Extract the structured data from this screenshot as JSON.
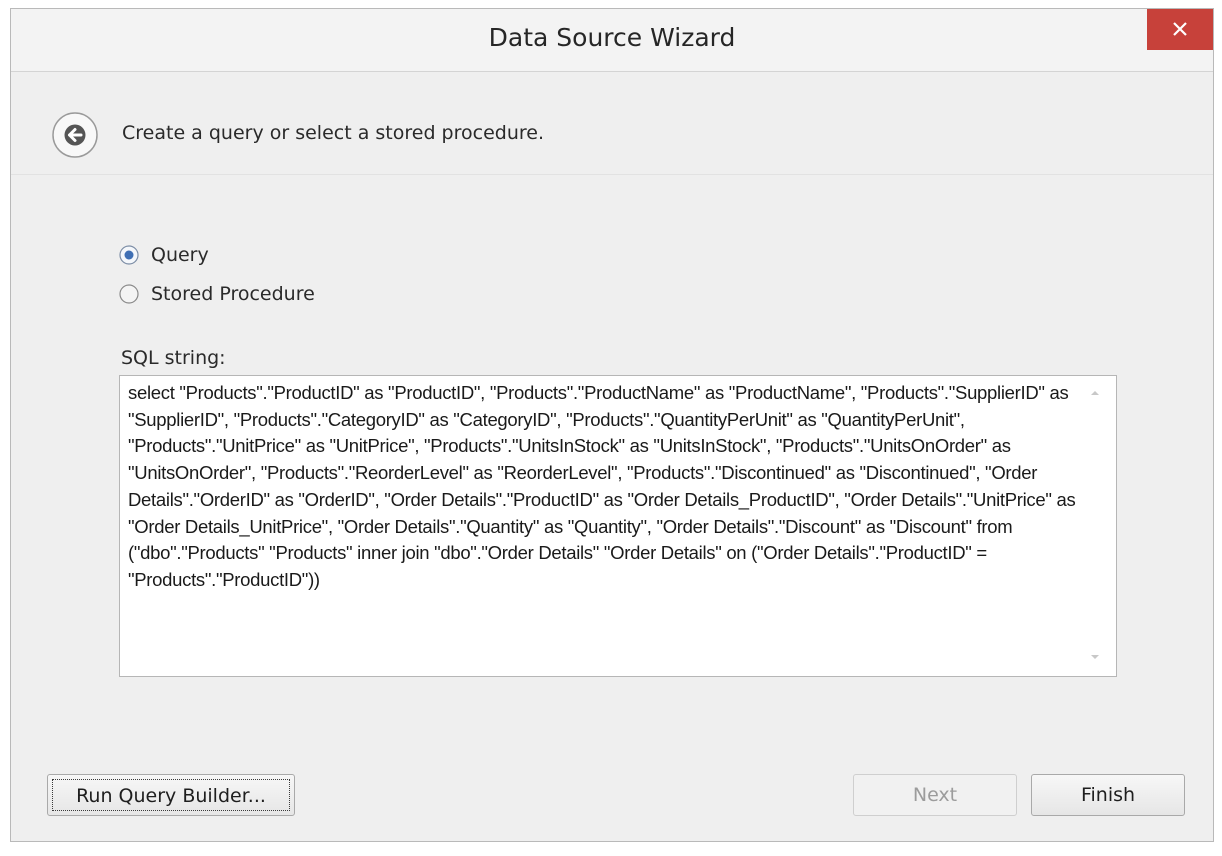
{
  "window": {
    "title": "Data Source Wizard"
  },
  "header": {
    "instruction": "Create a query or select a stored procedure."
  },
  "options": {
    "query_label": "Query",
    "stored_procedure_label": "Stored Procedure",
    "selected": "Query"
  },
  "sql": {
    "label": "SQL string:",
    "value": "select \"Products\".\"ProductID\" as \"ProductID\", \"Products\".\"ProductName\" as \"ProductName\", \"Products\".\"SupplierID\" as \"SupplierID\", \"Products\".\"CategoryID\" as \"CategoryID\", \"Products\".\"QuantityPerUnit\" as \"QuantityPerUnit\", \"Products\".\"UnitPrice\" as \"UnitPrice\", \"Products\".\"UnitsInStock\" as \"UnitsInStock\", \"Products\".\"UnitsOnOrder\" as \"UnitsOnOrder\", \"Products\".\"ReorderLevel\" as \"ReorderLevel\", \"Products\".\"Discontinued\" as \"Discontinued\", \"Order Details\".\"OrderID\" as \"OrderID\", \"Order Details\".\"ProductID\" as \"Order Details_ProductID\", \"Order Details\".\"UnitPrice\" as \"Order Details_UnitPrice\", \"Order Details\".\"Quantity\" as \"Quantity\", \"Order Details\".\"Discount\" as \"Discount\" from (\"dbo\".\"Products\" \"Products\" inner join \"dbo\".\"Order Details\" \"Order Details\" on (\"Order Details\".\"ProductID\" = \"Products\".\"ProductID\"))"
  },
  "buttons": {
    "run_query_builder": "Run Query Builder...",
    "next": "Next",
    "finish": "Finish"
  },
  "colors": {
    "close_button": "#c7413a",
    "window_background": "#efefef"
  }
}
